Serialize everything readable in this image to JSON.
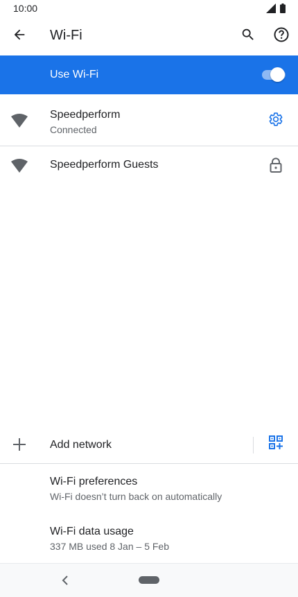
{
  "status_bar": {
    "time": "10:00",
    "icons": [
      "signal-icon",
      "battery-icon"
    ]
  },
  "app_bar": {
    "title": "Wi-Fi",
    "actions": [
      "search-icon",
      "help-icon"
    ]
  },
  "use_wifi": {
    "label": "Use Wi-Fi",
    "enabled": true,
    "accent": "#1a73e8"
  },
  "networks": [
    {
      "name": "Speedperform",
      "status": "Connected",
      "action_icon": "gear-icon"
    },
    {
      "name": "Speedperform Guests",
      "status": "",
      "action_icon": "lock-icon"
    }
  ],
  "add_network": {
    "label": "Add network"
  },
  "preferences": {
    "title": "Wi-Fi preferences",
    "subtitle": "Wi-Fi doesn’t turn back on automatically"
  },
  "data_usage": {
    "title": "Wi-Fi data usage",
    "subtitle": "337 MB used 8 Jan – 5 Feb"
  }
}
